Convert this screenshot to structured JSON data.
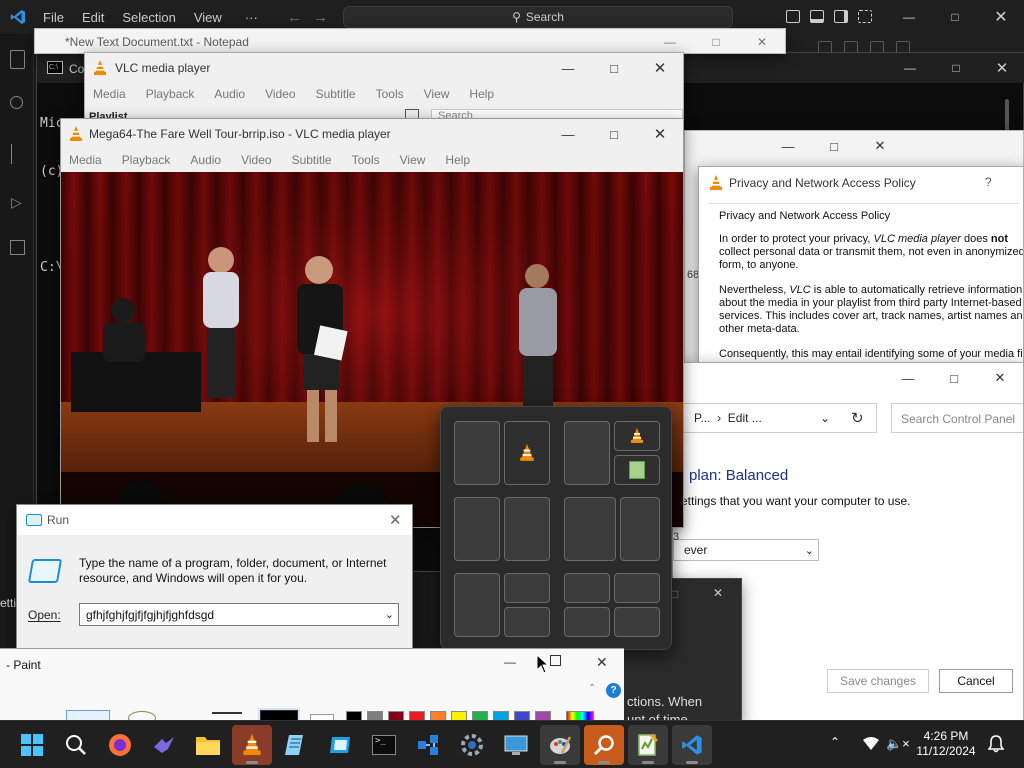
{
  "vscode": {
    "menu": [
      "File",
      "Edit",
      "Selection",
      "View",
      "···"
    ],
    "search_label": "Search"
  },
  "notepad": {
    "title": "*New Text Document.txt - Notepad"
  },
  "cmd": {
    "title": "Co",
    "lines": [
      "Micros",
      "(c) Mi",
      "",
      "C:\\"
    ]
  },
  "vlc_playlist": {
    "title": "VLC media player",
    "menu": [
      "Media",
      "Playback",
      "Audio",
      "Video",
      "Subtitle",
      "Tools",
      "View",
      "Help"
    ],
    "playlist_label": "Playlist",
    "search_placeholder": "Search"
  },
  "vlc_main": {
    "title": "Mega64-The Fare Well Tour-brrip.iso - VLC media player",
    "menu": [
      "Media",
      "Playback",
      "Audio",
      "Video",
      "Subtitle",
      "Tools",
      "View",
      "Help"
    ]
  },
  "privacy": {
    "title": "Privacy and Network Access Policy",
    "help": "?",
    "heading": "Privacy and Network Access Policy",
    "p1_before": "In order to protect your privacy, ",
    "p1_app": "VLC media player",
    "p1_mid": " does ",
    "p1_bold": "not",
    "p1_after": " collect personal data or transmit them, not even in anonymized form, to anyone.",
    "p2_before": "Nevertheless, ",
    "p2_app": "VLC",
    "p2_after": " is able to automatically retrieve information about the media in your playlist from third party Internet-based services. This includes cover art, track names, artist names and other meta-data.",
    "p3": "Consequently, this may entail identifying some of your media fil"
  },
  "behind_fragments": {
    "num": "68",
    "num2": "3",
    "settings_edge": "etti"
  },
  "control_panel": {
    "breadcrumb": "P...  ›  Edit ...",
    "search_placeholder": "Search Control Panel",
    "plan_title": "plan: Balanced",
    "plan_desc": "ettings that you want your computer to use.",
    "dropdown_value": "ever",
    "save_label": "Save changes",
    "cancel_label": "Cancel"
  },
  "dark_dialog": {
    "text1": "ctions. When",
    "text2": "unt of time"
  },
  "run": {
    "title": "Run",
    "description": "Type the name of a program, folder, document, or Internet resource, and Windows will open it for you.",
    "open_label": "Open:",
    "input_value": "gfhjfghjfgjfjfgjhjfjghfdsgd"
  },
  "paint": {
    "title": "- Paint"
  },
  "snap_layouts": {
    "layouts": 6
  },
  "taskbar": {
    "time": "4:26 PM",
    "date": "11/12/2024",
    "apps": [
      "start",
      "search",
      "firefox",
      "tool",
      "file-explorer",
      "vlc",
      "notepad",
      "app",
      "terminal",
      "network-app",
      "settings",
      "remote-desktop",
      "paint",
      "search-app",
      "notepad-plus",
      "vscode"
    ]
  },
  "colors": {
    "accent": "#0078d4",
    "vlc_orange": "#f08a00",
    "taskbar_bg": "#202020",
    "vscode_bg": "#181818"
  }
}
